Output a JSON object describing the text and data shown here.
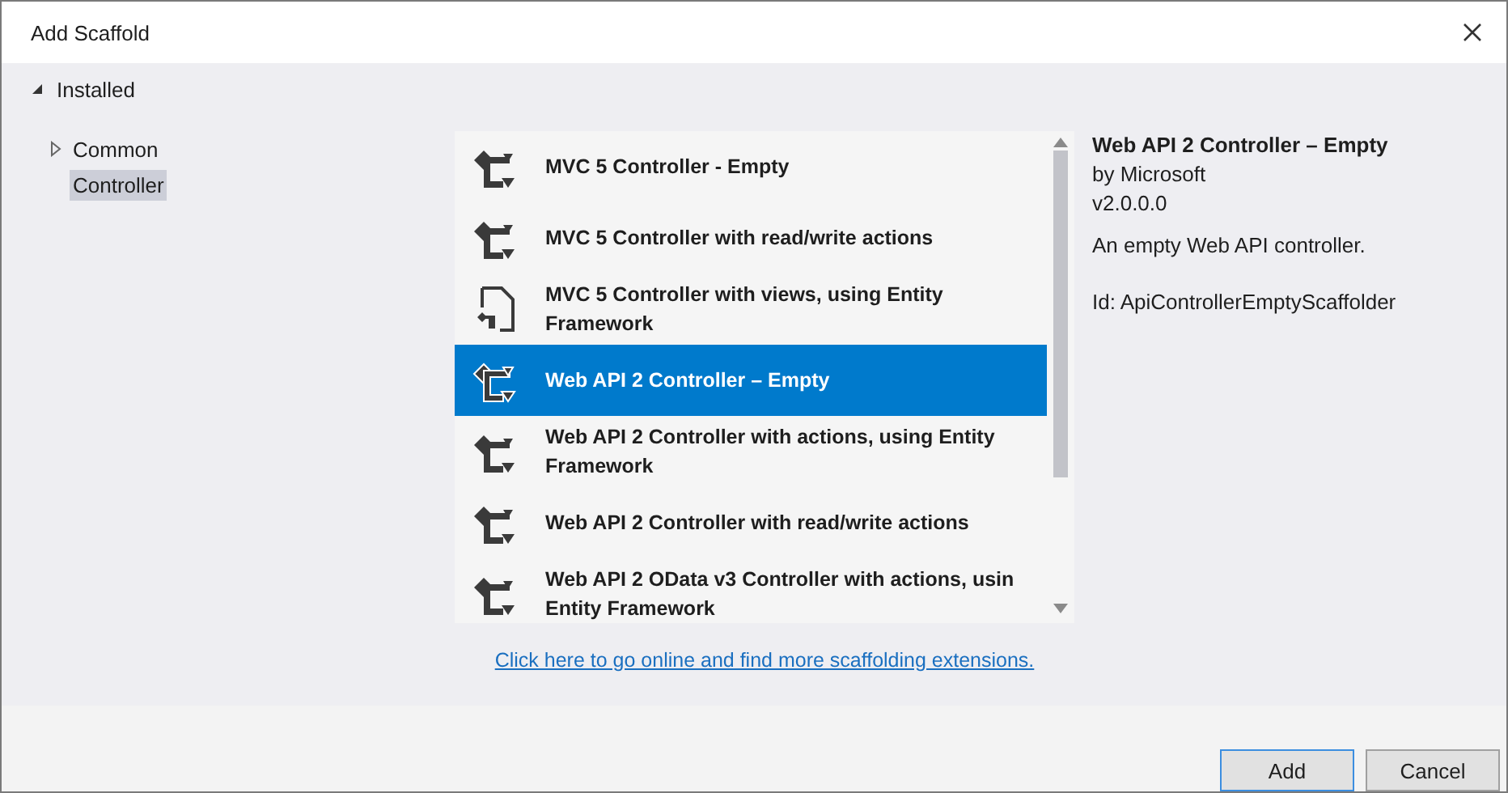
{
  "window": {
    "title": "Add Scaffold"
  },
  "tree": {
    "label": "Installed",
    "expanded": true,
    "children": [
      {
        "label": "Common",
        "expanded": false,
        "selected": false
      },
      {
        "label": "Controller",
        "selected": true
      }
    ]
  },
  "templates": [
    {
      "kind": "controller",
      "label": "MVC 5 Controller - Empty",
      "selected": false
    },
    {
      "kind": "controller",
      "label": "MVC 5 Controller with read/write actions",
      "selected": false
    },
    {
      "kind": "document",
      "label": "MVC 5 Controller with views, using Entity Framework",
      "selected": false
    },
    {
      "kind": "controller",
      "label": "Web API 2 Controller – Empty",
      "selected": true
    },
    {
      "kind": "controller",
      "label": "Web API 2 Controller with actions, using Entity Framework",
      "selected": false
    },
    {
      "kind": "controller",
      "label": "Web API 2 Controller with read/write actions",
      "selected": false
    },
    {
      "kind": "controller",
      "label": "Web API 2 OData v3 Controller with actions, usin\nEntity Framework",
      "selected": false
    }
  ],
  "details": {
    "title": "Web API 2 Controller – Empty",
    "author": "by Microsoft",
    "version": "v2.0.0.0",
    "description": "An empty Web API controller.",
    "id": "Id: ApiControllerEmptyScaffolder"
  },
  "link": "Click here to go online and find more scaffolding extensions.",
  "buttons": [
    {
      "label": "Add",
      "default": true
    },
    {
      "label": "Cancel",
      "default": false
    }
  ]
}
